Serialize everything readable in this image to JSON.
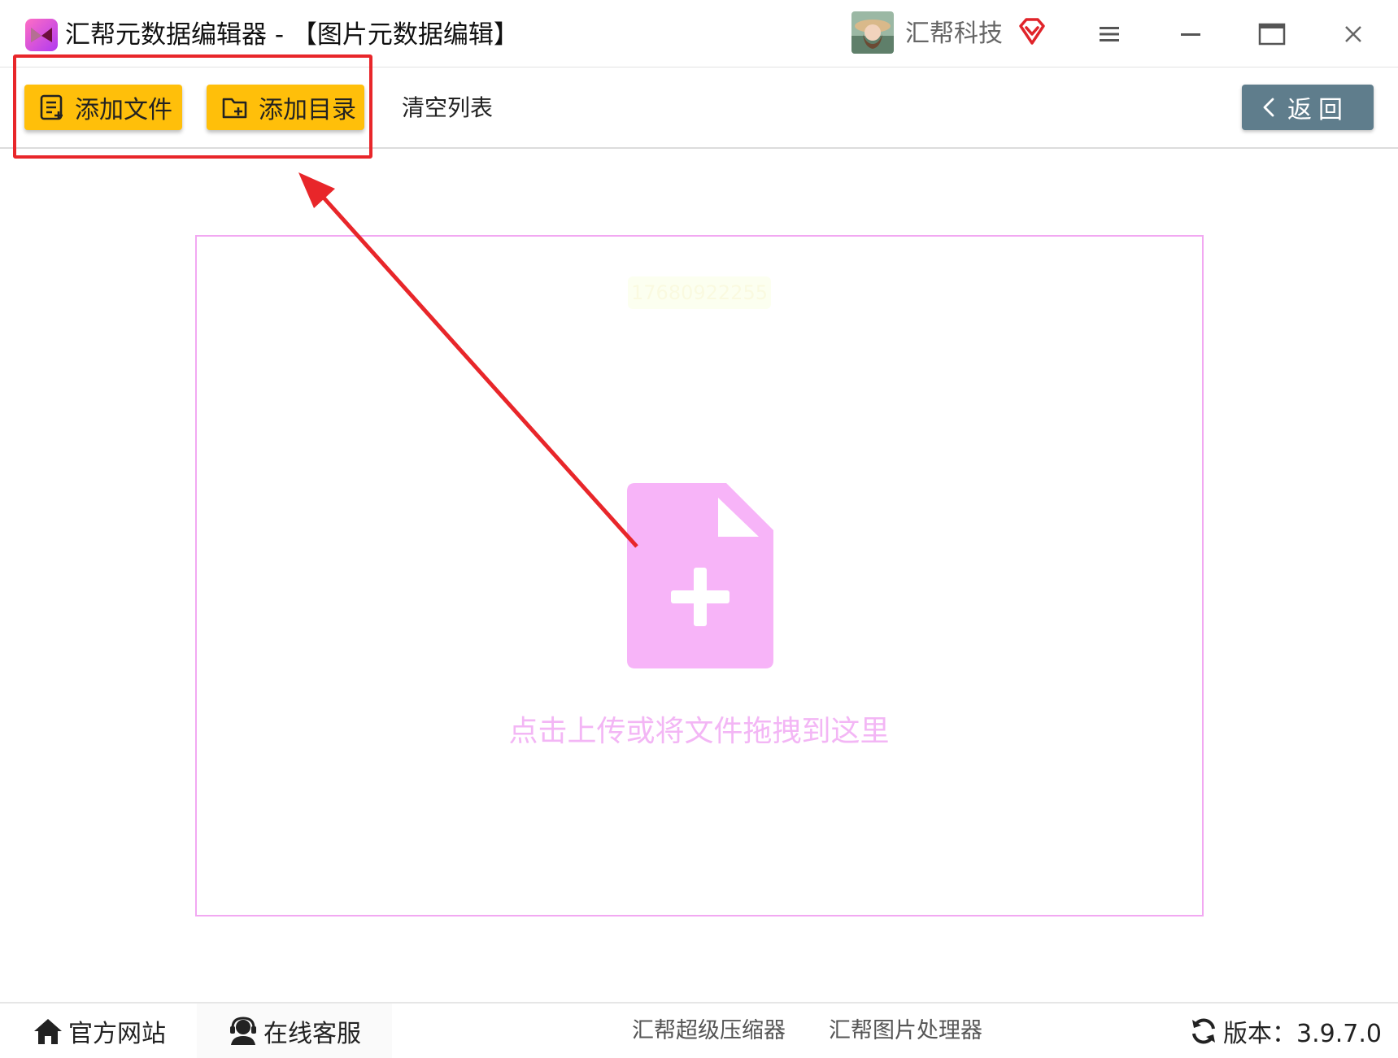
{
  "window": {
    "title": "汇帮元数据编辑器 - 【图片元数据编辑】",
    "user_name": "汇帮科技"
  },
  "toolbar": {
    "add_file_label": "添加文件",
    "add_folder_label": "添加目录",
    "clear_list_label": "清空列表",
    "back_label": "返回"
  },
  "dropzone": {
    "watermark": "17680922255",
    "hint": "点击上传或将文件拖拽到这里"
  },
  "statusbar": {
    "website_label": "官方网站",
    "support_label": "在线客服",
    "compressor_link": "汇帮超级压缩器",
    "image_processor_link": "汇帮图片处理器",
    "version_label": "版本：3.9.7.0"
  },
  "colors": {
    "accent_yellow": "#ffbf0a",
    "back_button": "#5f7d8c",
    "dropzone_pink": "#f3b6f5",
    "annotation_red": "#e8262a"
  },
  "icons": {
    "app": "app-logo-icon",
    "vip": "vip-diamond-icon",
    "menu": "menu-icon",
    "minimize": "minimize-icon",
    "maximize": "maximize-icon",
    "close": "close-icon",
    "add_file": "file-list-icon",
    "add_folder": "folder-add-icon",
    "back": "chevron-left-icon",
    "upload": "file-add-icon",
    "home": "home-icon",
    "support": "headset-icon",
    "refresh": "refresh-icon"
  }
}
